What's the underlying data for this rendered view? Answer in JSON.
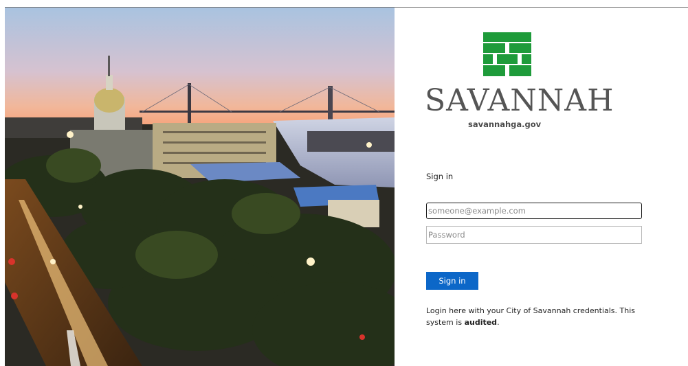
{
  "branding": {
    "wordmark": "SAVANNAH",
    "domain": "savannahga.gov",
    "logo_color": "#1e9b3a"
  },
  "form": {
    "title": "Sign in",
    "email_placeholder": "someone@example.com",
    "password_placeholder": "Password",
    "submit_label": "Sign in",
    "notice_text": "Login here with your City of Savannah credentials. This system is ",
    "notice_emphasis": "audited",
    "notice_end": ".",
    "button_color": "#0c67c8"
  },
  "background": {
    "photo_icon": "city-skyline-photo"
  }
}
